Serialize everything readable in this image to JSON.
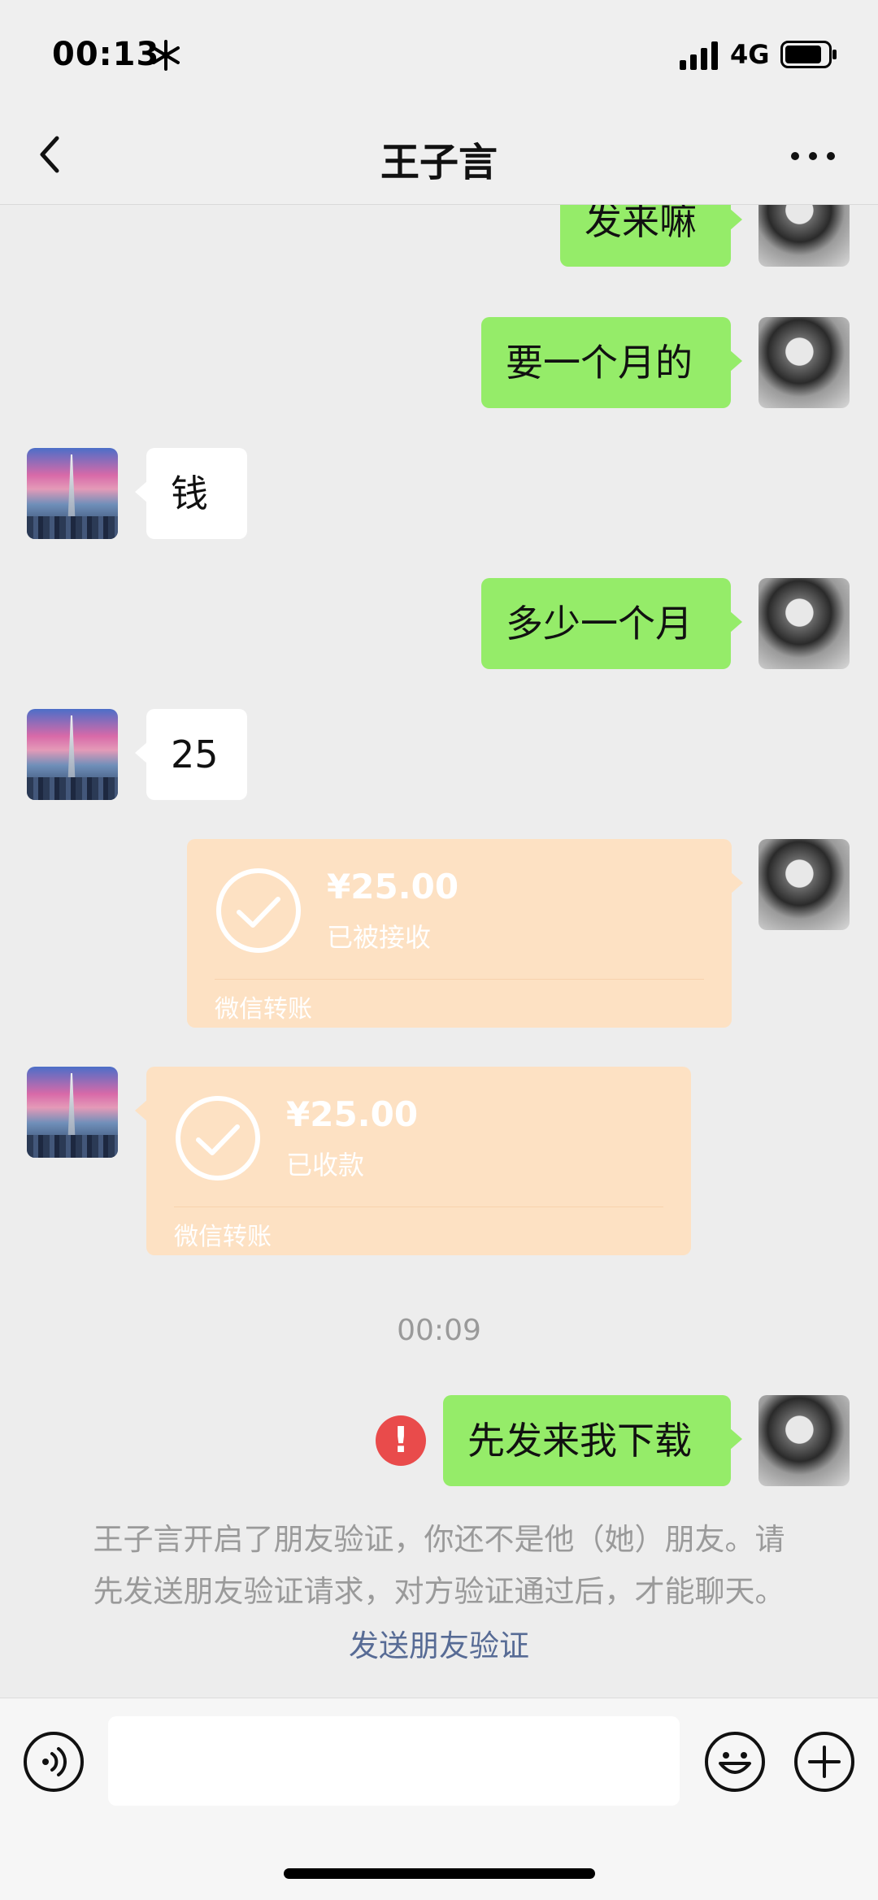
{
  "status_bar": {
    "time": "00:13",
    "network": "4G",
    "icons": [
      "snowflake-icon",
      "signal-icon",
      "battery-icon"
    ]
  },
  "header": {
    "title": "王子言",
    "back_icon": "chevron-left-icon",
    "more_icon": "more-dots-icon"
  },
  "messages": [
    {
      "from": "me",
      "type": "text",
      "text": "发来嘛"
    },
    {
      "from": "me",
      "type": "text",
      "text": "要一个月的"
    },
    {
      "from": "other",
      "type": "text",
      "text": "钱"
    },
    {
      "from": "me",
      "type": "text",
      "text": "多少一个月"
    },
    {
      "from": "other",
      "type": "text",
      "text": "25"
    },
    {
      "from": "me",
      "type": "transfer",
      "amount": "¥25.00",
      "status": "已被接收",
      "footer": "微信转账"
    },
    {
      "from": "other",
      "type": "transfer",
      "amount": "¥25.00",
      "status": "已收款",
      "footer": "微信转账"
    },
    {
      "type": "timestamp",
      "text": "00:09"
    },
    {
      "from": "me",
      "type": "text",
      "text": "先发来我下载",
      "failed": true,
      "failed_icon": "!"
    }
  ],
  "system_notice": {
    "line1": "王子言开启了朋友验证，你还不是他（她）朋友。请",
    "line2": "先发送朋友验证请求，对方验证通过后，才能聊天。",
    "link": "发送朋友验证"
  },
  "input_bar": {
    "value": "",
    "icons": [
      "voice-icon",
      "emoji-icon",
      "plus-icon"
    ]
  },
  "colors": {
    "my_bubble": "#95ec69",
    "other_bubble": "#ffffff",
    "transfer_card": "#fde1c3",
    "link": "#576b95",
    "error": "#e94b4b"
  }
}
